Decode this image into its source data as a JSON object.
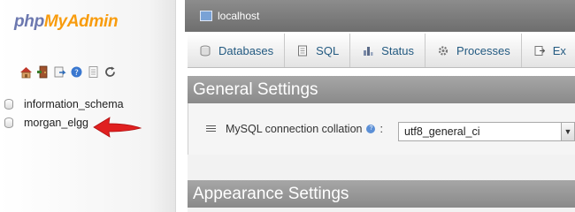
{
  "logo": {
    "part1": "php",
    "part2": "MyAdmin"
  },
  "nav_icons": [
    "home-icon",
    "exit-icon",
    "query-window-icon",
    "help-icon",
    "docs-icon",
    "reload-icon"
  ],
  "databases": [
    {
      "name": "information_schema"
    },
    {
      "name": "morgan_elgg"
    }
  ],
  "annotation": {
    "arrow_color": "#e02020"
  },
  "server": {
    "label": "localhost"
  },
  "tabs": [
    {
      "label": "Databases",
      "icon": "database-icon"
    },
    {
      "label": "SQL",
      "icon": "sql-icon"
    },
    {
      "label": "Status",
      "icon": "status-icon"
    },
    {
      "label": "Processes",
      "icon": "processes-icon"
    },
    {
      "label": "Ex",
      "icon": "export-icon"
    }
  ],
  "general_settings": {
    "title": "General Settings",
    "collation_label": "MySQL connection collation",
    "collation_value": "utf8_general_ci"
  },
  "appearance_settings": {
    "title": "Appearance Settings"
  },
  "colors": {
    "logo_php": "#6c78af",
    "logo_myadmin": "#f89c0e",
    "tab_text": "#235a81",
    "header_gray": "#8a8a8a"
  }
}
